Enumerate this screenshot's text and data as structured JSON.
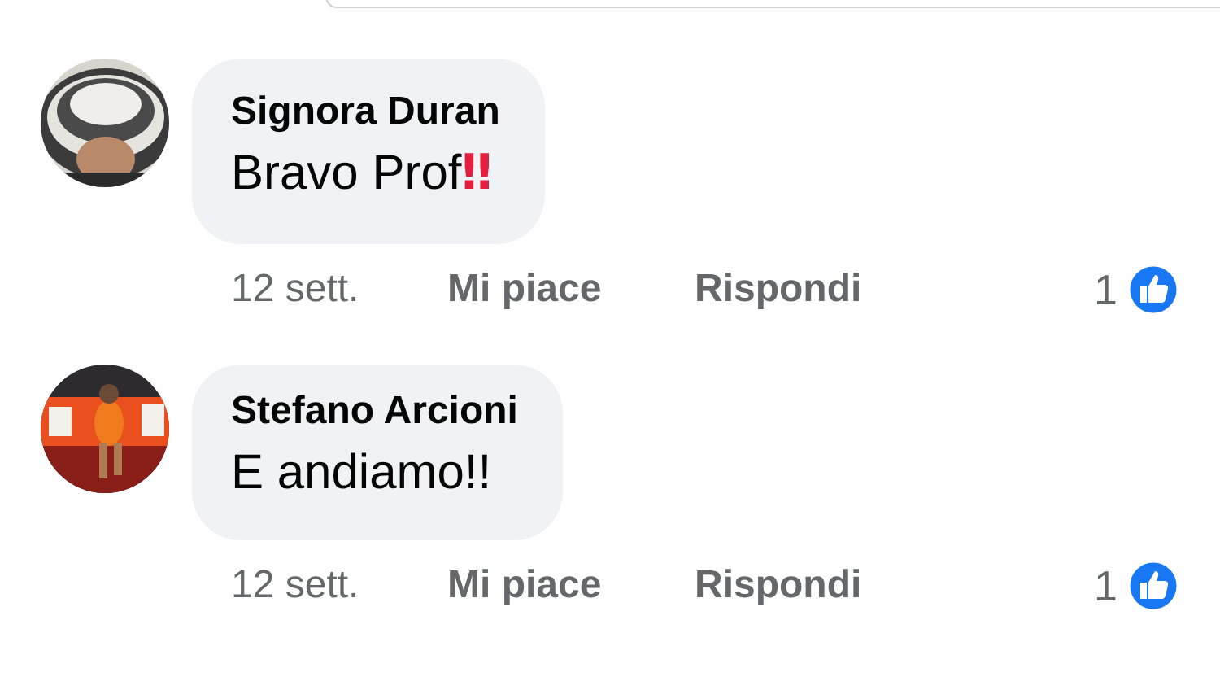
{
  "comments": [
    {
      "author": "Signora Duran",
      "text": "Bravo Prof",
      "emoji": "‼",
      "time": "12 sett.",
      "like_action": "Mi piace",
      "reply_action": "Rispondi",
      "reaction_count": "1"
    },
    {
      "author": "Stefano Arcioni",
      "text": "E andiamo!!",
      "time": "12 sett.",
      "like_action": "Mi piace",
      "reply_action": "Rispondi",
      "reaction_count": "1"
    }
  ]
}
